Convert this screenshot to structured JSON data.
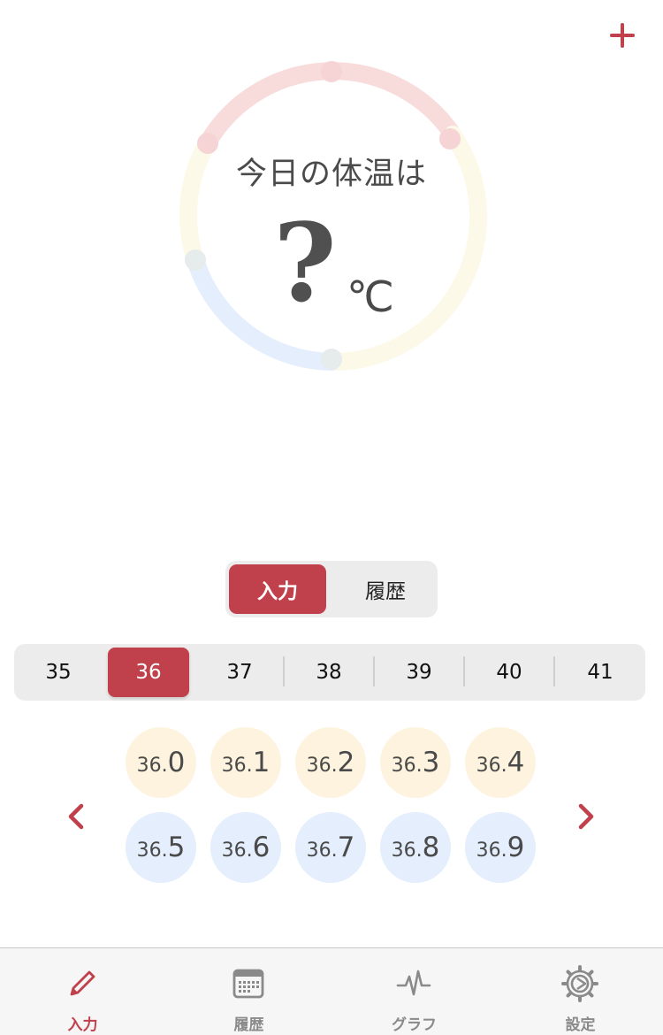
{
  "colors": {
    "accent": "#c0404b",
    "warm_circle": "#fdf3de",
    "cool_circle": "#e4eefc",
    "gauge_red": "#f8dcdc",
    "gauge_yellow": "#fdf9e8",
    "gauge_blue": "#e4eefc",
    "gauge_dot": "#e6ebec"
  },
  "header": {
    "add_icon": "plus-icon"
  },
  "gauge": {
    "title": "今日の体温は",
    "value": "?",
    "unit": "℃"
  },
  "mode_toggle": {
    "options": [
      "入力",
      "履歴"
    ],
    "selected": "入力"
  },
  "integer_selector": {
    "options": [
      "35",
      "36",
      "37",
      "38",
      "39",
      "40",
      "41"
    ],
    "selected": "36"
  },
  "decimal_picker": {
    "rows": [
      [
        {
          "int": "36.",
          "frac": "0",
          "tone": "warm"
        },
        {
          "int": "36.",
          "frac": "1",
          "tone": "warm"
        },
        {
          "int": "36.",
          "frac": "2",
          "tone": "warm"
        },
        {
          "int": "36.",
          "frac": "3",
          "tone": "warm"
        },
        {
          "int": "36.",
          "frac": "4",
          "tone": "warm"
        }
      ],
      [
        {
          "int": "36.",
          "frac": "5",
          "tone": "cool"
        },
        {
          "int": "36.",
          "frac": "6",
          "tone": "cool"
        },
        {
          "int": "36.",
          "frac": "7",
          "tone": "cool"
        },
        {
          "int": "36.",
          "frac": "8",
          "tone": "cool"
        },
        {
          "int": "36.",
          "frac": "9",
          "tone": "cool"
        }
      ]
    ],
    "prev_icon": "chevron-left-icon",
    "next_icon": "chevron-right-icon"
  },
  "tabbar": {
    "items": [
      {
        "label": "入力",
        "icon": "pencil-icon",
        "active": true
      },
      {
        "label": "履歴",
        "icon": "calendar-icon",
        "active": false
      },
      {
        "label": "グラフ",
        "icon": "pulse-icon",
        "active": false
      },
      {
        "label": "設定",
        "icon": "gear-icon",
        "active": false
      }
    ]
  }
}
